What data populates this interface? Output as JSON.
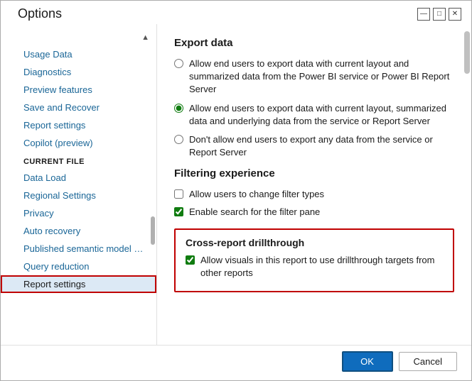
{
  "dialog": {
    "title": "Options",
    "minimize_label": "minimize",
    "maximize_label": "maximize",
    "close_label": "×"
  },
  "sidebar": {
    "global_section": {
      "items": [
        {
          "id": "usage-data",
          "label": "Usage Data"
        },
        {
          "id": "diagnostics",
          "label": "Diagnostics"
        },
        {
          "id": "preview-features",
          "label": "Preview features"
        },
        {
          "id": "save-and-recover",
          "label": "Save and Recover"
        },
        {
          "id": "report-settings",
          "label": "Report settings"
        },
        {
          "id": "copilot",
          "label": "Copilot (preview)"
        }
      ],
      "collapse_icon": "▲"
    },
    "current_file_section": {
      "header": "CURRENT FILE",
      "items": [
        {
          "id": "data-load",
          "label": "Data Load"
        },
        {
          "id": "regional-settings",
          "label": "Regional Settings"
        },
        {
          "id": "privacy",
          "label": "Privacy"
        },
        {
          "id": "auto-recovery",
          "label": "Auto recovery"
        },
        {
          "id": "published-semantic",
          "label": "Published semantic model set..."
        },
        {
          "id": "query-reduction",
          "label": "Query reduction"
        },
        {
          "id": "report-settings-file",
          "label": "Report settings",
          "active": true
        }
      ],
      "scroll_indicator": true
    }
  },
  "main": {
    "export_data": {
      "title": "Export data",
      "options": [
        {
          "id": "opt1",
          "selected": false,
          "label": "Allow end users to export data with current layout and summarized data from the Power BI service or Power BI Report Server"
        },
        {
          "id": "opt2",
          "selected": true,
          "label": "Allow end users to export data with current layout, summarized data and underlying data from the service or Report Server"
        },
        {
          "id": "opt3",
          "selected": false,
          "label": "Don't allow end users to export any data from the service or Report Server"
        }
      ]
    },
    "filtering_experience": {
      "title": "Filtering experience",
      "options": [
        {
          "id": "filter1",
          "checked": false,
          "label": "Allow users to change filter types"
        },
        {
          "id": "filter2",
          "checked": true,
          "label": "Enable search for the filter pane"
        }
      ]
    },
    "cross_report": {
      "title": "Cross-report drillthrough",
      "options": [
        {
          "id": "cross1",
          "checked": true,
          "label": "Allow visuals in this report to use drillthrough targets from other reports"
        }
      ]
    }
  },
  "footer": {
    "ok_label": "OK",
    "cancel_label": "Cancel"
  }
}
